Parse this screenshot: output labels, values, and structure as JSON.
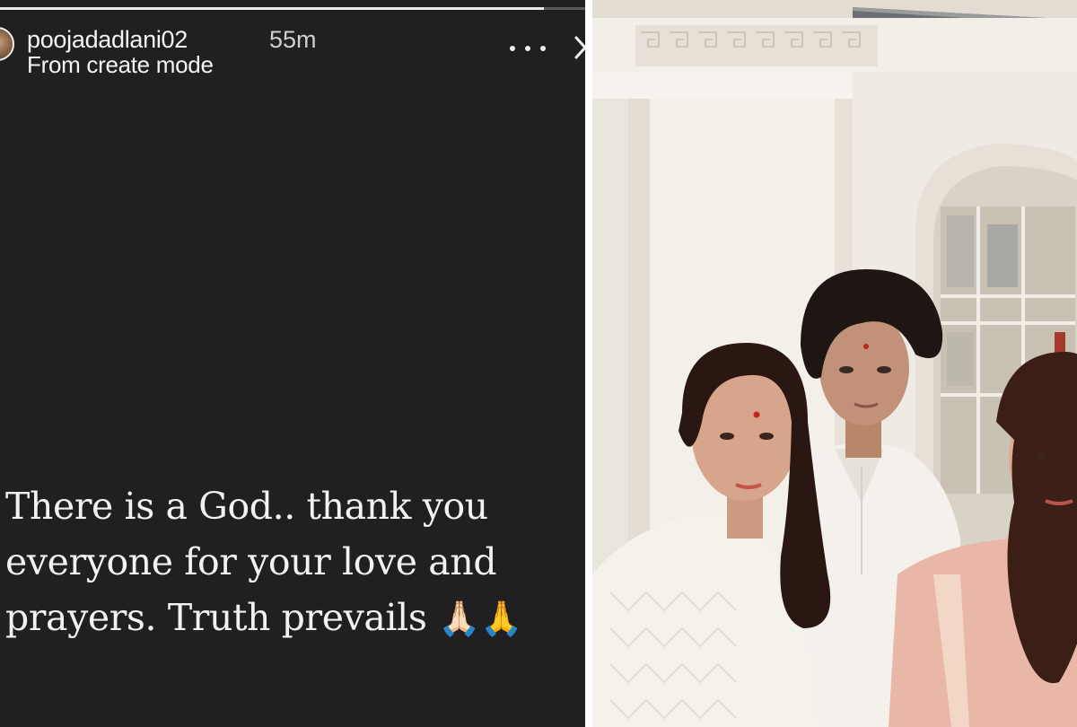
{
  "story": {
    "progress": 0.93,
    "username": "poojadadlani02",
    "timestamp": "55m",
    "subtitle": "From create mode",
    "more_icon": "more-horizontal-icon",
    "close_icon": "close-icon",
    "text_lines": [
      "There is a God.. thank you",
      "everyone for your love and",
      "prayers. Truth prevails"
    ],
    "emoji": "🙏🏻🙏",
    "colors": {
      "background": "#202022",
      "text": "#f2f2f2",
      "progress_track": "#5b5b5e",
      "progress_fill": "#e9e9ea"
    }
  },
  "photo": {
    "subject": "photo-of-three-people-in-white-room"
  }
}
